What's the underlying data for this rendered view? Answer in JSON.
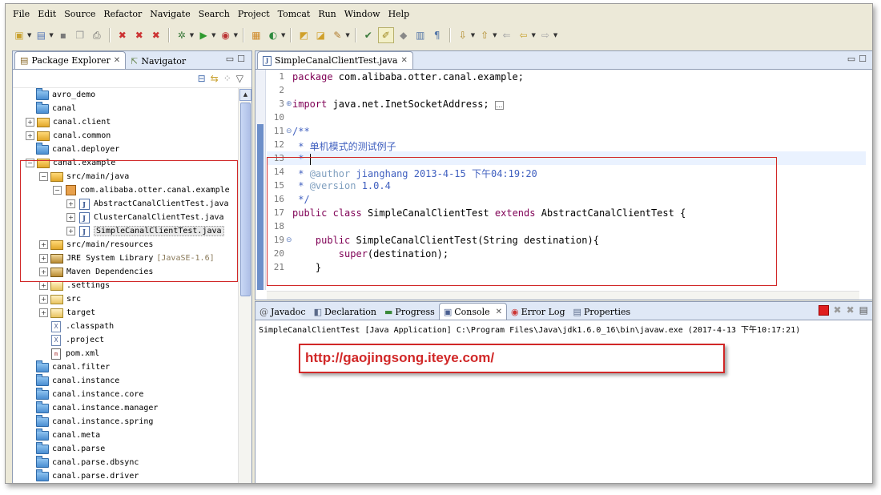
{
  "menu": [
    "File",
    "Edit",
    "Source",
    "Refactor",
    "Navigate",
    "Search",
    "Project",
    "Tomcat",
    "Run",
    "Window",
    "Help"
  ],
  "left_panel": {
    "tabs": [
      {
        "label": "Package Explorer",
        "active": true
      },
      {
        "label": "Navigator",
        "active": false
      }
    ],
    "tree": [
      {
        "label": "avro_demo",
        "indent": 0,
        "icon": "folder-icon",
        "expander": "none"
      },
      {
        "label": "canal",
        "indent": 0,
        "icon": "folder-icon",
        "expander": "none"
      },
      {
        "label": "canal.client",
        "indent": 0,
        "icon": "maven-project-icon",
        "expander": "plus"
      },
      {
        "label": "canal.common",
        "indent": 0,
        "icon": "maven-project-icon",
        "expander": "plus"
      },
      {
        "label": "canal.deployer",
        "indent": 0,
        "icon": "folder-icon",
        "expander": "none"
      },
      {
        "label": "canal.example",
        "indent": 0,
        "icon": "maven-project-icon",
        "expander": "minus"
      },
      {
        "label": "src/main/java",
        "indent": 1,
        "icon": "source-folder-icon",
        "expander": "minus"
      },
      {
        "label": "com.alibaba.otter.canal.example",
        "indent": 2,
        "icon": "package-icon",
        "expander": "minus"
      },
      {
        "label": "AbstractCanalClientTest.java",
        "indent": 3,
        "icon": "java-file-icon",
        "expander": "plus"
      },
      {
        "label": "ClusterCanalClientTest.java",
        "indent": 3,
        "icon": "java-file-icon",
        "expander": "plus"
      },
      {
        "label": "SimpleCanalClientTest.java",
        "indent": 3,
        "icon": "java-file-icon",
        "expander": "plus",
        "selected": true
      },
      {
        "label": "src/main/resources",
        "indent": 1,
        "icon": "source-folder-icon",
        "expander": "plus"
      },
      {
        "label": "JRE System Library",
        "suffix": "[JavaSE-1.6]",
        "indent": 1,
        "icon": "library-icon",
        "expander": "plus"
      },
      {
        "label": "Maven Dependencies",
        "indent": 1,
        "icon": "library-icon",
        "expander": "plus"
      },
      {
        "label": ".settings",
        "indent": 1,
        "icon": "open-folder-icon",
        "expander": "plus"
      },
      {
        "label": "src",
        "indent": 1,
        "icon": "open-folder-icon",
        "expander": "plus"
      },
      {
        "label": "target",
        "indent": 1,
        "icon": "open-folder-icon",
        "expander": "plus"
      },
      {
        "label": ".classpath",
        "indent": 1,
        "icon": "xml-file-icon",
        "expander": "none"
      },
      {
        "label": ".project",
        "indent": 1,
        "icon": "xml-file-icon",
        "expander": "none"
      },
      {
        "label": "pom.xml",
        "indent": 1,
        "icon": "maven-file-icon",
        "expander": "none"
      },
      {
        "label": "canal.filter",
        "indent": 0,
        "icon": "folder-icon",
        "expander": "none"
      },
      {
        "label": "canal.instance",
        "indent": 0,
        "icon": "folder-icon",
        "expander": "none"
      },
      {
        "label": "canal.instance.core",
        "indent": 0,
        "icon": "folder-icon",
        "expander": "none"
      },
      {
        "label": "canal.instance.manager",
        "indent": 0,
        "icon": "folder-icon",
        "expander": "none"
      },
      {
        "label": "canal.instance.spring",
        "indent": 0,
        "icon": "folder-icon",
        "expander": "none"
      },
      {
        "label": "canal.meta",
        "indent": 0,
        "icon": "folder-icon",
        "expander": "none"
      },
      {
        "label": "canal.parse",
        "indent": 0,
        "icon": "folder-icon",
        "expander": "none"
      },
      {
        "label": "canal.parse.dbsync",
        "indent": 0,
        "icon": "folder-icon",
        "expander": "none"
      },
      {
        "label": "canal.parse.driver",
        "indent": 0,
        "icon": "folder-icon",
        "expander": "none"
      }
    ]
  },
  "editor": {
    "tab_label": "SimpleCanalClientTest.java",
    "lines": [
      {
        "n": "1",
        "text": "package com.alibaba.otter.canal.example;"
      },
      {
        "n": "2",
        "text": ""
      },
      {
        "n": "3",
        "text": "import java.net.InetSocketAddress;"
      },
      {
        "n": "10",
        "text": ""
      },
      {
        "n": "11",
        "text": "/**"
      },
      {
        "n": "12",
        "text": " * 单机模式的测试例子"
      },
      {
        "n": "13",
        "text": " * "
      },
      {
        "n": "14",
        "text": " * @author jianghang 2013-4-15 下午04:19:20"
      },
      {
        "n": "15",
        "text": " * @version 1.0.4"
      },
      {
        "n": "16",
        "text": " */"
      },
      {
        "n": "17",
        "text": "public class SimpleCanalClientTest extends AbstractCanalClientTest {"
      },
      {
        "n": "18",
        "text": ""
      },
      {
        "n": "19",
        "text": "    public SimpleCanalClientTest(String destination){"
      },
      {
        "n": "20",
        "text": "        super(destination);"
      },
      {
        "n": "21",
        "text": "    }"
      }
    ]
  },
  "bottom_panel": {
    "tabs": [
      "Javadoc",
      "Declaration",
      "Progress",
      "Console",
      "Error Log",
      "Properties"
    ],
    "active_tab": "Console",
    "console_line": "SimpleCanalClientTest [Java Application] C:\\Program Files\\Java\\jdk1.6.0_16\\bin\\javaw.exe (2017-4-13 下午10:17:21)"
  },
  "watermark_url": "http://gaojingsong.iteye.com/",
  "colors": {
    "annotation": "#d12828",
    "keyword": "#7f0055",
    "comment": "#3f5fbf"
  }
}
